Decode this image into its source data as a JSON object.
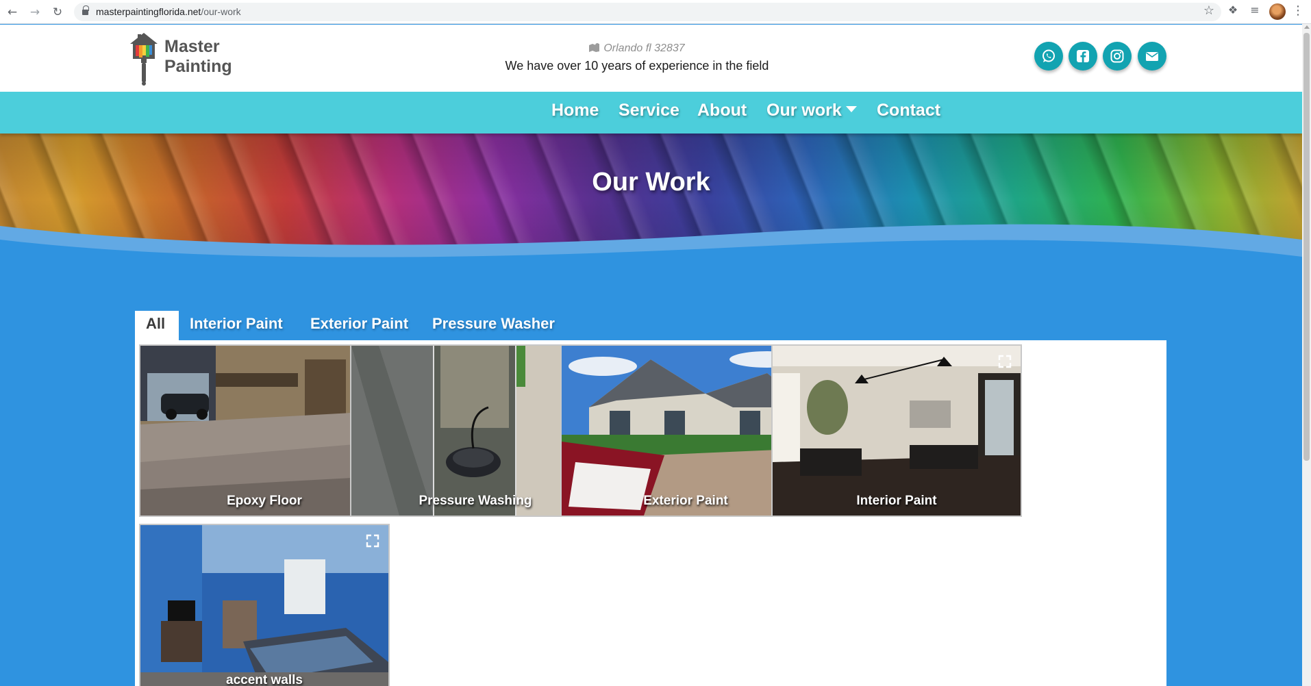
{
  "browser": {
    "url_host": "masterpaintingflorida.net",
    "url_path": "/our-work"
  },
  "header": {
    "logo_line1": "Master",
    "logo_line2": "Painting",
    "address": "Orlando fl 32837",
    "tagline": "We have over 10 years of experience in the field",
    "social": [
      "whatsapp-icon",
      "facebook-icon",
      "instagram-icon",
      "email-icon"
    ]
  },
  "nav": {
    "items": [
      "Home",
      "Service",
      "About",
      "Our work",
      "Contact"
    ]
  },
  "hero": {
    "title": "Our Work"
  },
  "filters": {
    "tabs": [
      "All",
      "Interior Paint",
      "Exterior Paint",
      "Pressure Washer"
    ],
    "active": "All"
  },
  "gallery": {
    "items": [
      {
        "caption": "Epoxy Floor"
      },
      {
        "caption": "Pressure Washing"
      },
      {
        "caption": "Exterior Paint"
      },
      {
        "caption": "Interior Paint"
      },
      {
        "caption": "accent walls"
      }
    ]
  },
  "colors": {
    "nav_bg": "#4ccedb",
    "page_bg": "#2f93e0",
    "social_bg": "#12a3b1"
  }
}
